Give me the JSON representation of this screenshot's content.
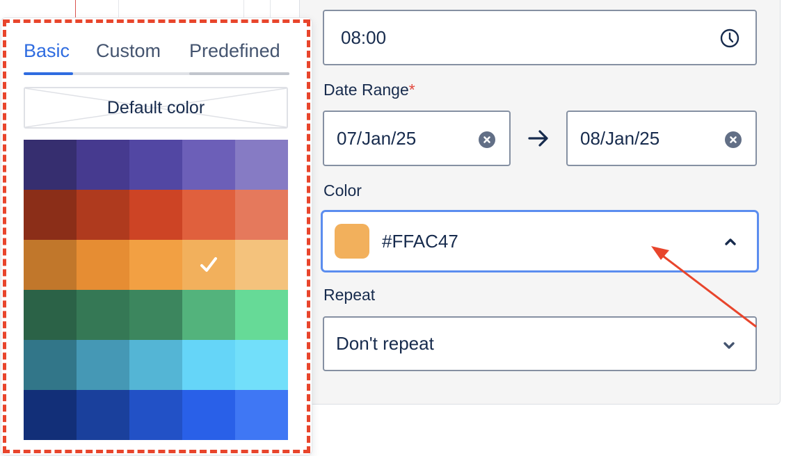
{
  "time": {
    "value": "08:00",
    "icon": "clock-icon"
  },
  "date_range": {
    "label": "Date Range",
    "required_mark": "*",
    "start": "07/Jan/25",
    "end": "08/Jan/25",
    "separator_icon": "arrow-right-icon",
    "clear_icon": "clear-icon"
  },
  "color": {
    "label": "Color",
    "value": "#FFAC47",
    "swatch_color": "#F2B05C",
    "expanded": true
  },
  "repeat": {
    "label": "Repeat",
    "value": "Don't repeat"
  },
  "picker": {
    "tabs": [
      {
        "label": "Basic",
        "active": true
      },
      {
        "label": "Custom",
        "active": false
      },
      {
        "label": "Predefined",
        "active": false
      }
    ],
    "default_label": "Default color",
    "selected": {
      "row": 2,
      "col": 3
    },
    "palette": [
      [
        "#362E6F",
        "#463A8F",
        "#5247A3",
        "#6C5FB8",
        "#867BC4"
      ],
      [
        "#8B2E18",
        "#AF3A1E",
        "#CD4425",
        "#E0603D",
        "#E5795C"
      ],
      [
        "#C1772B",
        "#E68D33",
        "#F2A043",
        "#F2B05C",
        "#F4C27C"
      ],
      [
        "#2B6247",
        "#357855",
        "#3C865E",
        "#53B37C",
        "#66DA97"
      ],
      [
        "#327689",
        "#4598B5",
        "#54B5D5",
        "#65D5F8",
        "#72DFFA"
      ],
      [
        "#122F78",
        "#1A409C",
        "#2251C6",
        "#2960E8",
        "#3F77F4"
      ]
    ]
  },
  "colors": {
    "accent": "#2F6CE0",
    "annotation": "#E8452C",
    "required": "#E2483D"
  }
}
